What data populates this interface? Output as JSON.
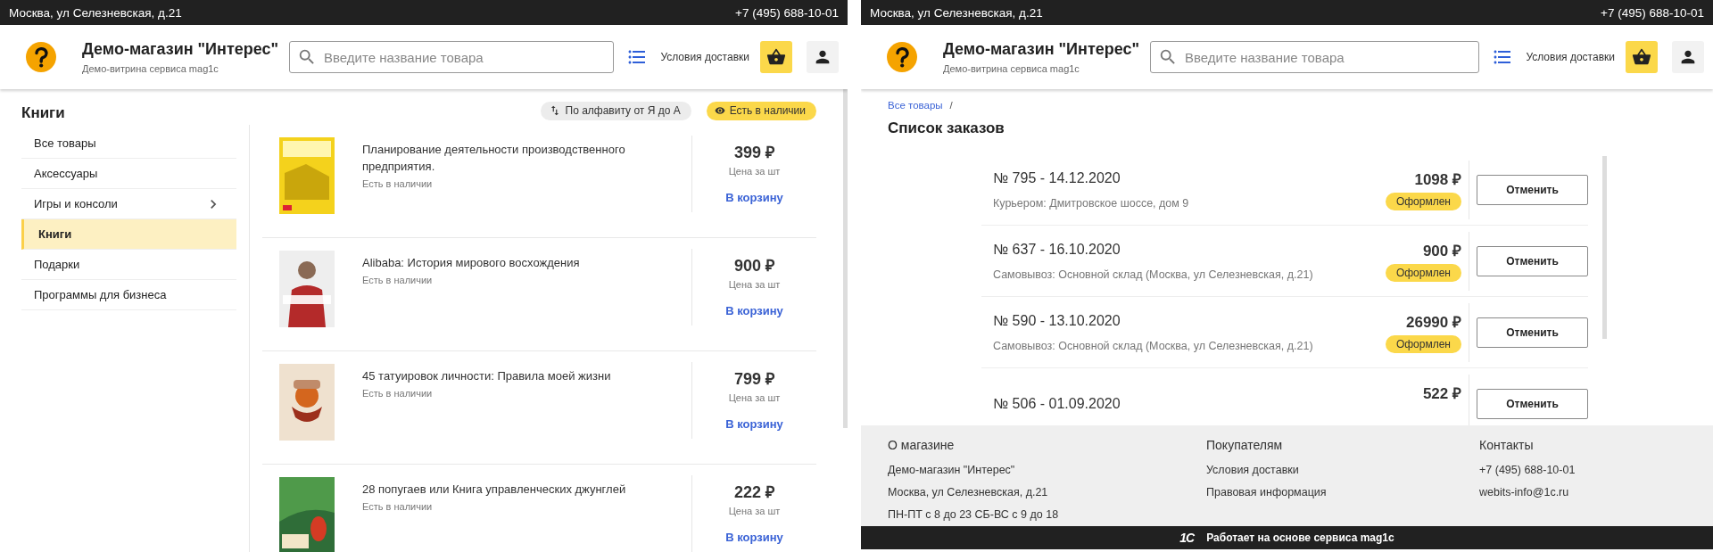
{
  "left_page": {
    "top_bar": {
      "address": "Москва, ул Селезневская, д.21",
      "phone": "+7 (495) 688-10-01"
    },
    "header": {
      "store_name": "Демо-магазин \"Интерес\"",
      "tagline": "Демо-витрина сервиса mag1c",
      "search": {
        "placeholder": "Введите название товара"
      },
      "delivery_link": "Условия доставки"
    },
    "category_title": "Книги",
    "filters": [
      {
        "kind": "sort",
        "label": "По алфавиту от Я до А",
        "selected": false
      },
      {
        "kind": "availability",
        "label": "Есть в наличии",
        "selected": true
      }
    ],
    "categories": [
      {
        "label": "Все товары",
        "selected": false,
        "has_children": false
      },
      {
        "label": "Аксессуары",
        "selected": false,
        "has_children": false
      },
      {
        "label": "Игры и консоли",
        "selected": false,
        "has_children": true
      },
      {
        "label": "Книги",
        "selected": true,
        "has_children": false
      },
      {
        "label": "Подарки",
        "selected": false,
        "has_children": false
      },
      {
        "label": "Программы для бизнеса",
        "selected": false,
        "has_children": false
      }
    ],
    "products": [
      {
        "title": "Планирование деятельности производственного предприятия.",
        "availability": "Есть в наличии",
        "price": "399 ₽",
        "price_note": "Цена за шт",
        "cart_link": "В корзину"
      },
      {
        "title": "Alibaba: История мирового восхождения",
        "availability": "Есть в наличии",
        "price": "900 ₽",
        "price_note": "Цена за шт",
        "cart_link": "В корзину"
      },
      {
        "title": "45 татуировок личности: Правила моей жизни",
        "availability": "Есть в наличии",
        "price": "799 ₽",
        "price_note": "Цена за шт",
        "cart_link": "В корзину"
      },
      {
        "title": "28 попугаев или Книга управленческих джунглей",
        "availability": "Есть в наличии",
        "price": "222 ₽",
        "price_note": "Цена за шт",
        "cart_link": "В корзину"
      }
    ]
  },
  "right_page": {
    "top_bar": {
      "address": "Москва, ул Селезневская, д.21",
      "phone": "+7 (495) 688-10-01"
    },
    "header": {
      "store_name": "Демо-магазин \"Интерес\"",
      "tagline": "Демо-витрина сервиса mag1c",
      "search": {
        "placeholder": "Введите название товара"
      },
      "delivery_link": "Условия доставки"
    },
    "breadcrumb": {
      "items": [
        "Все товары"
      ],
      "separator": "/"
    },
    "title": "Список заказов",
    "orders": [
      {
        "number_date": "№ 795 - 14.12.2020",
        "delivery": "Курьером: Дмитровское шоссе, дом 9",
        "total": "1098 ₽",
        "status": "Оформлен",
        "action": "Отменить"
      },
      {
        "number_date": "№ 637 - 16.10.2020",
        "delivery": "Самовывоз: Основной склад (Москва, ул Селезневская, д.21)",
        "total": "900 ₽",
        "status": "Оформлен",
        "action": "Отменить"
      },
      {
        "number_date": "№ 590 - 13.10.2020",
        "delivery": "Самовывоз: Основной склад (Москва, ул Селезневская, д.21)",
        "total": "26990 ₽",
        "status": "Оформлен",
        "action": "Отменить"
      },
      {
        "number_date": "№ 506 - 01.09.2020",
        "total": "522 ₽",
        "action": "Отменить"
      }
    ],
    "footer": {
      "columns": [
        {
          "heading": "О магазине",
          "items": [
            "Демо-магазин \"Интерес\"",
            "Москва, ул Селезневская, д.21",
            "ПН-ПТ с 8 до 23 СБ-ВС с 9 до 18"
          ]
        },
        {
          "heading": "Покупателям",
          "items": [
            "Условия доставки",
            "Правовая информация"
          ]
        },
        {
          "heading": "Контакты",
          "items": [
            "+7 (495) 688-10-01",
            "webits-info@1c.ru"
          ]
        }
      ],
      "logo_text": "1С",
      "powered_by": "Работает на основе сервиса mag1c"
    }
  }
}
